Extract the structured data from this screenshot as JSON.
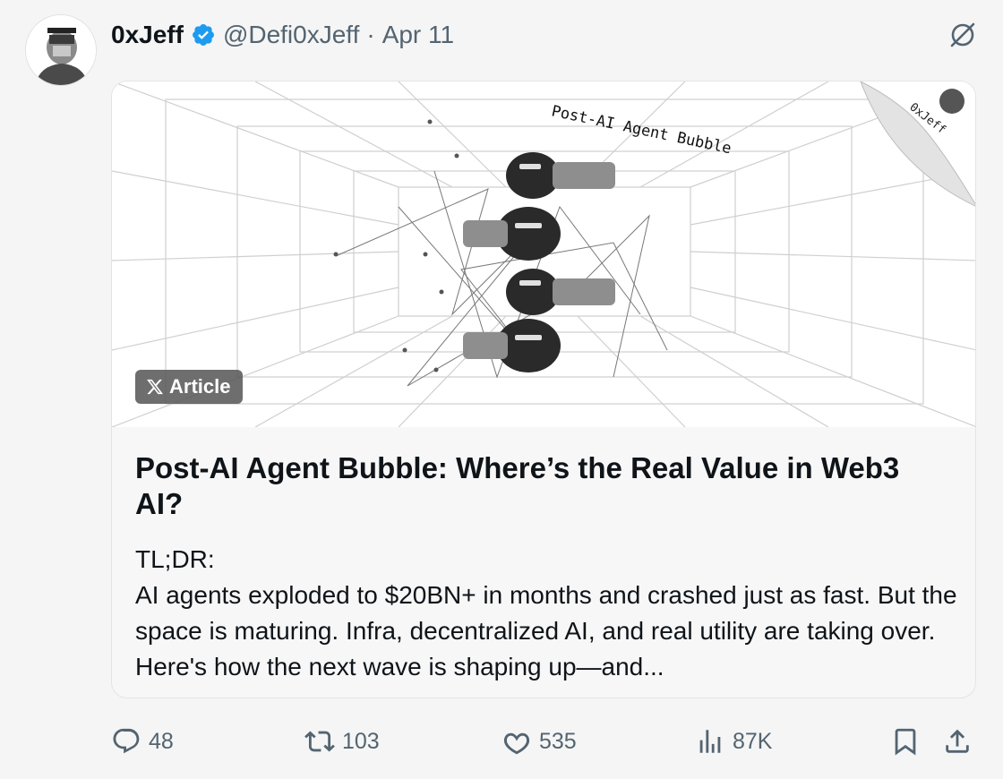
{
  "tweet": {
    "author_name": "0xJeff",
    "handle": "@Defi0xJeff",
    "separator": "·",
    "date": "Apr 11",
    "verified": true
  },
  "card": {
    "badge_label": "Article",
    "image_caption": "Post-AI Agent Bubble",
    "watermark": "0xJeff",
    "title": "Post-AI Agent Bubble: Where’s the Real Value in Web3 AI?",
    "excerpt_heading": "TL;DR:",
    "excerpt_body": "AI agents exploded to $20BN+ in months and crashed just as fast. But the space is maturing. Infra, decentralized AI, and real utility are taking over. Here's how the next wave is shaping up—and..."
  },
  "actions": {
    "replies": "48",
    "reposts": "103",
    "likes": "535",
    "views": "87K"
  },
  "icons": {
    "verified": "verified-badge-icon",
    "grok": "grok-icon",
    "reply": "reply-icon",
    "repost": "repost-icon",
    "like": "heart-icon",
    "views": "analytics-icon",
    "bookmark": "bookmark-icon",
    "share": "share-icon",
    "x_logo": "x-logo-icon"
  },
  "colors": {
    "verified": "#1d9bf0",
    "text": "#0f1419",
    "muted": "#536471",
    "badge_bg": "#5a5a5a"
  }
}
